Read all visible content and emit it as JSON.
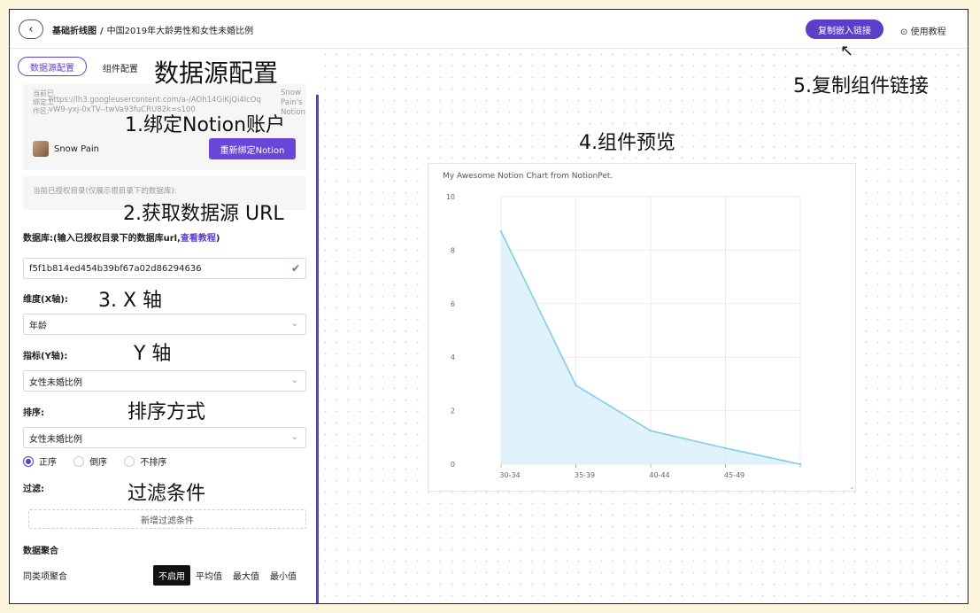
{
  "topbar": {
    "back_icon": "‹",
    "crumb_main": "基础折线图",
    "crumb_sep": "/",
    "crumb_title": "中国2019年大龄男性和女性未婚比例",
    "copy_button": "复制嵌入链接",
    "help_label": "使用教程",
    "accent": "#5b3fc8"
  },
  "sidebar": {
    "tab_datasource": "数据源配置",
    "tab_component": "组件配置",
    "account": {
      "label": "当前已绑定工作区:",
      "url": "https://lh3.googleusercontent.com/a-/AOh14GiKjQi4lcOqvW9-yxj-0xTV--twVa93fuCRU82k=s100",
      "side_text": "Snow Pain's Notion",
      "name": "Snow Pain",
      "rebind_button": "重新绑定Notion"
    },
    "auth_text": "当前已授权目录(仅展示根目录下的数据库):",
    "db_label": "数据库:(输入已授权目录下的数据库url,",
    "db_link": "查看教程",
    "db_label_end": ")",
    "db_value": "f5f1b814ed454b39bf67a02d86294636",
    "x_label": "维度(X轴):",
    "x_value": "年龄",
    "y_label": "指标(Y轴):",
    "y_value": "女性未婚比例",
    "sort_label": "排序:",
    "sort_value": "女性未婚比例",
    "sort_options": [
      "正序",
      "倒序",
      "不排序"
    ],
    "filter_label": "过滤:",
    "filter_button": "新增过滤条件",
    "agg_title": "数据聚合",
    "agg_label": "同类项聚合",
    "agg_options": [
      "不启用",
      "平均值",
      "最大值",
      "最小值"
    ]
  },
  "annotations": {
    "a_title": "数据源配置",
    "a1": "1.绑定Notion账户",
    "a2": "2.获取数据源 URL",
    "a3": "3. X 轴",
    "a4": "Y 轴",
    "a5": "排序方式",
    "a6": "过滤条件",
    "a7": "4.组件预览",
    "a8": "5.复制组件链接"
  },
  "chart_data": {
    "type": "area",
    "title": "My Awesome Notion Chart from NotionPet.",
    "categories": [
      "30-34",
      "35-39",
      "40-44",
      "45-49",
      ""
    ],
    "values": [
      8.7,
      2.95,
      1.25,
      0.6,
      0
    ],
    "ylim": [
      0,
      10
    ],
    "yticks": [
      0,
      2,
      4,
      6,
      8,
      10
    ],
    "line_color": "#7fcfe8",
    "fill_color": "#d6effb",
    "grid": true
  }
}
